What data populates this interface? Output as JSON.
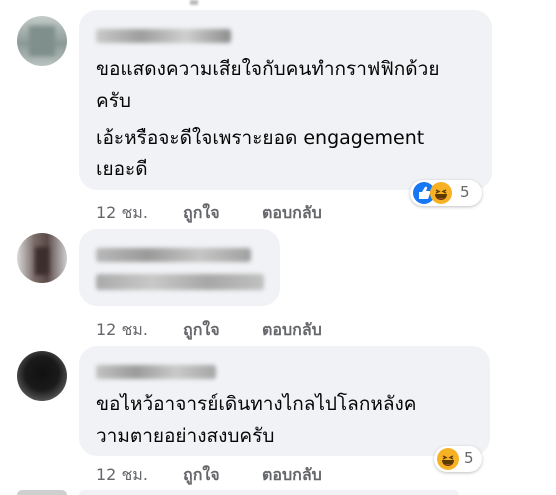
{
  "comments": [
    {
      "lines": [
        "ขอแสดงความเสียใจกับคนทำกราฟฟิกด้วย",
        "ครับ"
      ],
      "lines2": [
        "เอ้ะหรือจะดีใจเพราะยอด engagement",
        "เยอะดี"
      ],
      "time": "12 ชม.",
      "like": "ถูกใจ",
      "reply": "ตอบกลับ",
      "reaction_count": "5",
      "reaction_icons": [
        "like-icon",
        "haha-icon"
      ]
    },
    {
      "lines": [],
      "time": "12 ชม.",
      "like": "ถูกใจ",
      "reply": "ตอบกลับ"
    },
    {
      "lines": [
        "ขอไหว้อาจารย์เดินทางไกลไปโลกหลังค",
        "วามตายอย่างสงบครับ"
      ],
      "time": "12 ชม.",
      "like": "ถูกใจ",
      "reply": "ตอบกลับ",
      "reaction_count": "5",
      "reaction_icons": [
        "haha-icon"
      ]
    }
  ],
  "colors": {
    "bubble": "#f0f2f5",
    "meta": "#65676b",
    "like_blue": "#1877f2",
    "haha_yellow": "#f7b125"
  }
}
